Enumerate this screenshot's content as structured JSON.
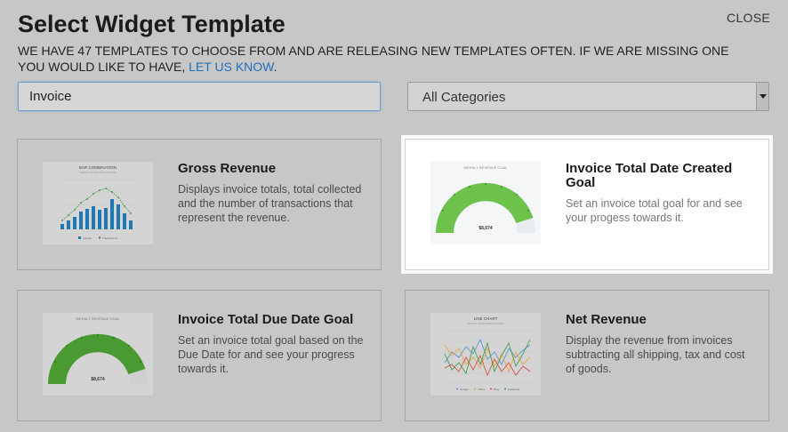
{
  "header": {
    "title": "Select Widget Template",
    "close_label": "CLOSE",
    "description": "WE HAVE 47 TEMPLATES TO CHOOSE FROM AND ARE RELEASING NEW TEMPLATES OFTEN. IF WE ARE MISSING ONE YOU WOULD LIKE TO HAVE,",
    "link_label": "LET US KNOW"
  },
  "search": {
    "value": "Invoice"
  },
  "category_select": {
    "selected": "All Categories"
  },
  "cards": [
    {
      "title": "Gross Revenue",
      "description": "Displays invoice totals, total collected and the number of transactions that represent the revenue.",
      "thumb_title": "BAR COMBINATION",
      "thumb_subtitle": "SERIES MIXED BRIGHTNESS",
      "thumb_legend": [
        "Sample",
        "Transactions"
      ]
    },
    {
      "title": "Invoice Total Date Created Goal",
      "description": "Set an invoice total goal for and see your progess towards it.",
      "thumb_title": "WEEKLY REVENUE GOAL",
      "thumb_value": "$8,674"
    },
    {
      "title": "Invoice Total Due Date Goal",
      "description": "Set an invoice total goal based on the Due Date for and see your progress towards it.",
      "thumb_title": "WEEKLY REVENUE GOAL",
      "thumb_value": "$8,674"
    },
    {
      "title": "Net Revenue",
      "description": "Display the revenue from invoices subtracting all shipping, tax and cost of goods.",
      "thumb_title": "LINE CHART",
      "thumb_subtitle": "SERIES MIXED BRIGHTNESS",
      "thumb_legend": [
        "Google",
        "Yahoo",
        "Bing",
        "Facebook"
      ]
    }
  ],
  "colors": {
    "link": "#1d6fb8",
    "gauge_green": "#6cc24a",
    "bar_blue": "#1f77b4"
  }
}
